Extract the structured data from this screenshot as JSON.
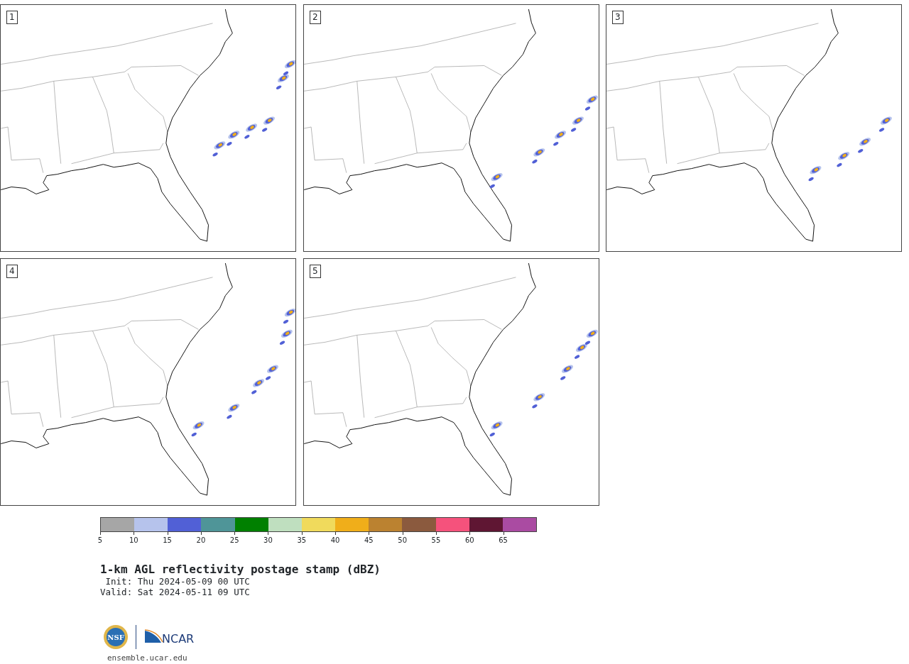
{
  "panels": [
    {
      "label": "1"
    },
    {
      "label": "2"
    },
    {
      "label": "3"
    },
    {
      "label": "4"
    },
    {
      "label": "5"
    }
  ],
  "colorbar": {
    "bins": [
      {
        "label": "5",
        "color": "#a6a6a6"
      },
      {
        "label": "10",
        "color": "#b6c3ec"
      },
      {
        "label": "15",
        "color": "#5160d6"
      },
      {
        "label": "20",
        "color": "#4f9598"
      },
      {
        "label": "25",
        "color": "#008000"
      },
      {
        "label": "30",
        "color": "#bfdfbf"
      },
      {
        "label": "35",
        "color": "#f0da5c"
      },
      {
        "label": "40",
        "color": "#f0ae1a"
      },
      {
        "label": "45",
        "color": "#bb8230"
      },
      {
        "label": "50",
        "color": "#8b5a3e"
      },
      {
        "label": "55",
        "color": "#f5527c"
      },
      {
        "label": "60",
        "color": "#5f1633"
      },
      {
        "label": "65",
        "color": "#aa4ba2"
      }
    ]
  },
  "title": "1-km AGL reflectivity postage stamp (dBZ)",
  "init": " Init: Thu 2024-05-09 00 UTC",
  "valid": "Valid: Sat 2024-05-11 09 UTC",
  "logos": {
    "nsf": "NSF",
    "ncar": "NCAR"
  },
  "url": "ensemble.ucar.edu"
}
